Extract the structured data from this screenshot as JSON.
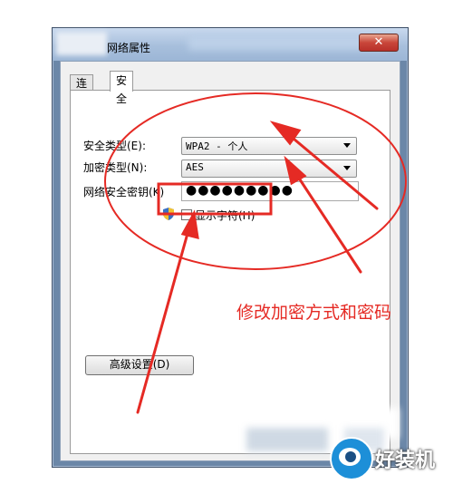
{
  "window": {
    "title": "网络属性",
    "close_label": "✕"
  },
  "tabs": [
    {
      "label": "连接",
      "active": false
    },
    {
      "label": "安全",
      "active": true
    }
  ],
  "security": {
    "type_label": "安全类型(E):",
    "type_value": "WPA2 - 个人",
    "encryption_label": "加密类型(N):",
    "encryption_value": "AES",
    "key_label": "网络安全密钥(K)",
    "key_value": "●●●●●●●●●",
    "show_chars_label": "显示字符(H)",
    "show_chars_checked": false
  },
  "advanced_button": "高级设置(D)",
  "annotation": {
    "text": "修改加密方式和密码",
    "color": "#e52a24"
  },
  "watermark": {
    "text": "好装机"
  },
  "colors": {
    "annotation_red": "#e52a24",
    "title_gradient": "#a7bfdc",
    "brand_blue": "#1d8fd8"
  }
}
